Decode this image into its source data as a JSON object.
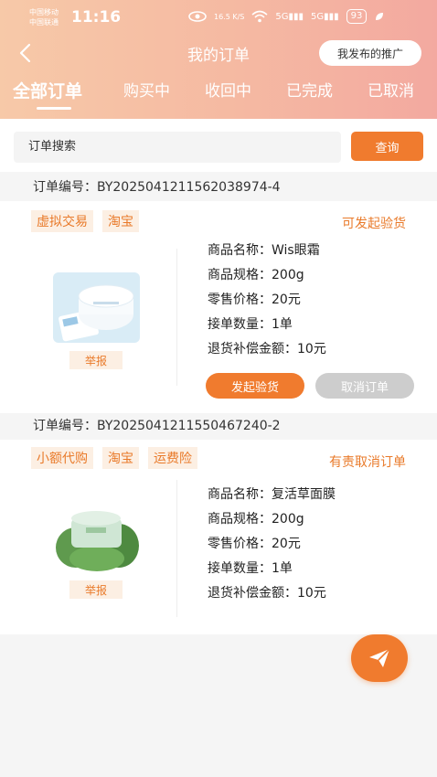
{
  "status_bar": {
    "carrier1": "中国移动",
    "carrier2": "中国联通",
    "time": "11:16",
    "net_speed": "16.5 K/S",
    "signal1": "5G",
    "signal2": "5G",
    "battery": "93"
  },
  "nav": {
    "title": "我的订单",
    "promo_button": "我发布的推广"
  },
  "tabs": [
    {
      "label": "全部订单",
      "active": true
    },
    {
      "label": "购买中",
      "active": false
    },
    {
      "label": "收回中",
      "active": false
    },
    {
      "label": "已完成",
      "active": false
    },
    {
      "label": "已取消",
      "active": false
    }
  ],
  "search": {
    "placeholder": "订单搜索",
    "button": "查询"
  },
  "orders": [
    {
      "order_no": "订单编号：BY20250412115620389​74-4",
      "tags": [
        "虚拟交易",
        "淘宝"
      ],
      "status": "可发起验货",
      "report": "举报",
      "details": [
        "商品名称：Wis眼霜",
        "商品规格：200g",
        "零售价格：20元",
        "接单数量：1单",
        "退货补偿金额：10元"
      ],
      "primary_button": "发起验货",
      "secondary_button": "取消订单"
    },
    {
      "order_no": "订单编号：BY20250412115504672​40-2",
      "tags": [
        "小额代购",
        "淘宝",
        "运费险"
      ],
      "status": "有责取消订单",
      "report": "举报",
      "details": [
        "商品名称：复活草面膜",
        "商品规格：200g",
        "零售价格：20元",
        "接单数量：1单",
        "退货补偿金额：10元"
      ]
    }
  ],
  "colors": {
    "accent": "#f07b2e",
    "tag_bg": "#fcefe3",
    "header_start": "#f7c9a8",
    "header_end": "#f3a9a0"
  },
  "fab_icon": "paper-plane-icon"
}
